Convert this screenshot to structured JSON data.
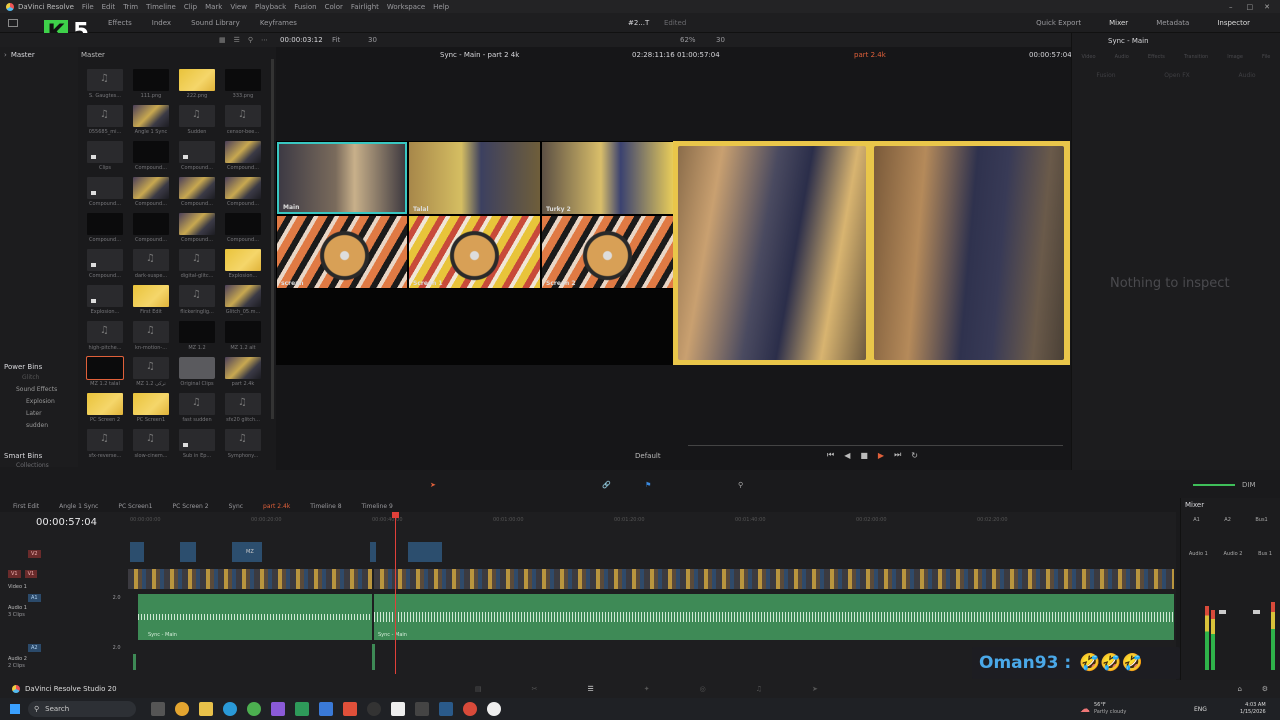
{
  "titlebar": {
    "app_name": "DaVinci Resolve",
    "menu": [
      "File",
      "Edit",
      "Trim",
      "Timeline",
      "Clip",
      "Mark",
      "View",
      "Playback",
      "Fusion",
      "Color",
      "Fairlight",
      "Workspace",
      "Help"
    ]
  },
  "toolbar": {
    "left_items": [
      "Effects",
      "Index",
      "Sound Library",
      "Keyframes"
    ],
    "project": "#2...T",
    "status": "Edited",
    "right_items": [
      "Quick Export",
      "Mixer",
      "Metadata",
      "Inspector"
    ]
  },
  "overlay_badge": {
    "letter": "K",
    "number": "5"
  },
  "media_pool": {
    "bin_master_left": "Master",
    "bin_master_right": "Master",
    "power_bins_title": "Power Bins",
    "power_bins": [
      "Glitch",
      "Sound Effects",
      "Explosion",
      "Later",
      "sudden"
    ],
    "smart_bins_title": "Smart Bins",
    "smart_bins_sub": "Collections",
    "items": [
      {
        "label": "S. Gaugtes...",
        "kind": "audio"
      },
      {
        "label": "111.png",
        "kind": "black"
      },
      {
        "label": "222.png",
        "kind": "yel"
      },
      {
        "label": "333.png",
        "kind": "black"
      },
      {
        "label": "055685_mi...",
        "kind": "audio"
      },
      {
        "label": "Angle 1 Sync",
        "kind": "vid"
      },
      {
        "label": "Sudden",
        "kind": "audio"
      },
      {
        "label": "censor-bee...",
        "kind": "audio"
      },
      {
        "label": "Clips",
        "kind": "mono"
      },
      {
        "label": "Compound...",
        "kind": "black"
      },
      {
        "label": "Compound...",
        "kind": "mono"
      },
      {
        "label": "Compound...",
        "kind": "vid"
      },
      {
        "label": "Compound...",
        "kind": "mono"
      },
      {
        "label": "Compound...",
        "kind": "vid"
      },
      {
        "label": "Compound...",
        "kind": "vid"
      },
      {
        "label": "Compound...",
        "kind": "vid"
      },
      {
        "label": "Compound...",
        "kind": "black"
      },
      {
        "label": "Compound...",
        "kind": "black"
      },
      {
        "label": "Compound...",
        "kind": "vid"
      },
      {
        "label": "Compound...",
        "kind": "black"
      },
      {
        "label": "Compound...",
        "kind": "mono"
      },
      {
        "label": "dark-suspe...",
        "kind": "audio"
      },
      {
        "label": "digital-glitc...",
        "kind": "audio"
      },
      {
        "label": "Explosion...",
        "kind": "yel"
      },
      {
        "label": "Explosion...",
        "kind": "mono"
      },
      {
        "label": "First Edit",
        "kind": "yel"
      },
      {
        "label": "flickeringlig...",
        "kind": "audio"
      },
      {
        "label": "Glitch_05.m...",
        "kind": "vid"
      },
      {
        "label": "high-pitche...",
        "kind": "audio"
      },
      {
        "label": "kn-motion-...",
        "kind": "audio"
      },
      {
        "label": "MZ 1.2",
        "kind": "black"
      },
      {
        "label": "MZ 1.2 alt",
        "kind": "black"
      },
      {
        "label": "MZ 1.2 talal",
        "kind": "black"
      },
      {
        "label": "MZ 1.2 ترکی",
        "kind": "audio"
      },
      {
        "label": "Original Clips",
        "kind": "folder"
      },
      {
        "label": "part 2.4k",
        "kind": "vid"
      },
      {
        "label": "PC Screen 2",
        "kind": "yel"
      },
      {
        "label": "PC Screen1",
        "kind": "yel"
      },
      {
        "label": "fast sudden",
        "kind": "audio"
      },
      {
        "label": "sfx20 glitch...",
        "kind": "audio"
      },
      {
        "label": "sfx-reverse...",
        "kind": "audio"
      },
      {
        "label": "slow-cinem...",
        "kind": "audio"
      },
      {
        "label": "Sub in Ep...",
        "kind": "mono"
      },
      {
        "label": "Symphony...",
        "kind": "audio"
      }
    ]
  },
  "viewer": {
    "timecode_left": "00:00:03:12",
    "fit": "Fit",
    "fps_left": "30",
    "title": "Sync - Main - part 2 4k",
    "timecode_mid": "02:28:11:16",
    "timecode_dur": "01:00:57:04",
    "zoom": "62%",
    "fps_right": "30",
    "clip_name": "part 2.4k",
    "timecode_right": "00:00:57:04",
    "multicam_angles": [
      "Main",
      "Talal",
      "Turky 2",
      "screan",
      "Screan 1",
      "Screan 2"
    ],
    "playback_label": "Default"
  },
  "inspector": {
    "title": "Sync - Main",
    "tabs": [
      "Video",
      "Audio",
      "Effects",
      "Transition",
      "Image",
      "File"
    ],
    "subtabs": [
      "Fusion",
      "Open FX",
      "Audio"
    ],
    "empty_text": "Nothing to inspect"
  },
  "timeline": {
    "tabs": [
      "First Edit",
      "Angle 1 Sync",
      "PC Screen1",
      "PC Screen 2",
      "Sync",
      "part 2.4k",
      "Timeline 8",
      "Timeline 9"
    ],
    "active_tab": "part 2.4k",
    "timecode": "00:00:57:04",
    "ruler": [
      "00:00:00:00",
      "00:00:20:00",
      "00:00:40:00",
      "00:01:00:00",
      "00:01:20:00",
      "00:01:40:00",
      "00:02:00:00",
      "00:02:20:00"
    ],
    "tracks": {
      "v2": "V2",
      "v1": "V1",
      "v1_name": "Video 1",
      "a1": "A1",
      "a1_name": "Audio 1",
      "a1_clips": "3 Clips",
      "a1_ch": "2.0",
      "a2": "A2",
      "a2_name": "Audio 2",
      "a2_clips": "2 Clips",
      "a2_ch": "2.0"
    },
    "v2_clip_label": "MZ",
    "audio_clip_labels": [
      "Sync - Main",
      "Sync - Main"
    ]
  },
  "mixer": {
    "title": "Mixer",
    "channels": [
      "A1",
      "A2",
      "Bus1"
    ],
    "channel_names": [
      "Audio 1",
      "Audio 2",
      "Bus 1"
    ],
    "dim": "DIM"
  },
  "chat_overlay": {
    "text": "Oman93 :",
    "emojis": "🤣🤣🤣"
  },
  "status_bar": {
    "app": "DaVinci Resolve Studio 20"
  },
  "taskbar": {
    "search": "Search",
    "weather_temp": "56°F",
    "weather_desc": "Partly cloudy",
    "lang": "ENG",
    "time": "4:03 AM",
    "date": "1/15/2026"
  },
  "colors": {
    "accent_orange": "#e0603a",
    "audio_green": "#3e8a56",
    "selection_teal": "#39c7c2",
    "chat_blue": "#4aa8e8"
  }
}
